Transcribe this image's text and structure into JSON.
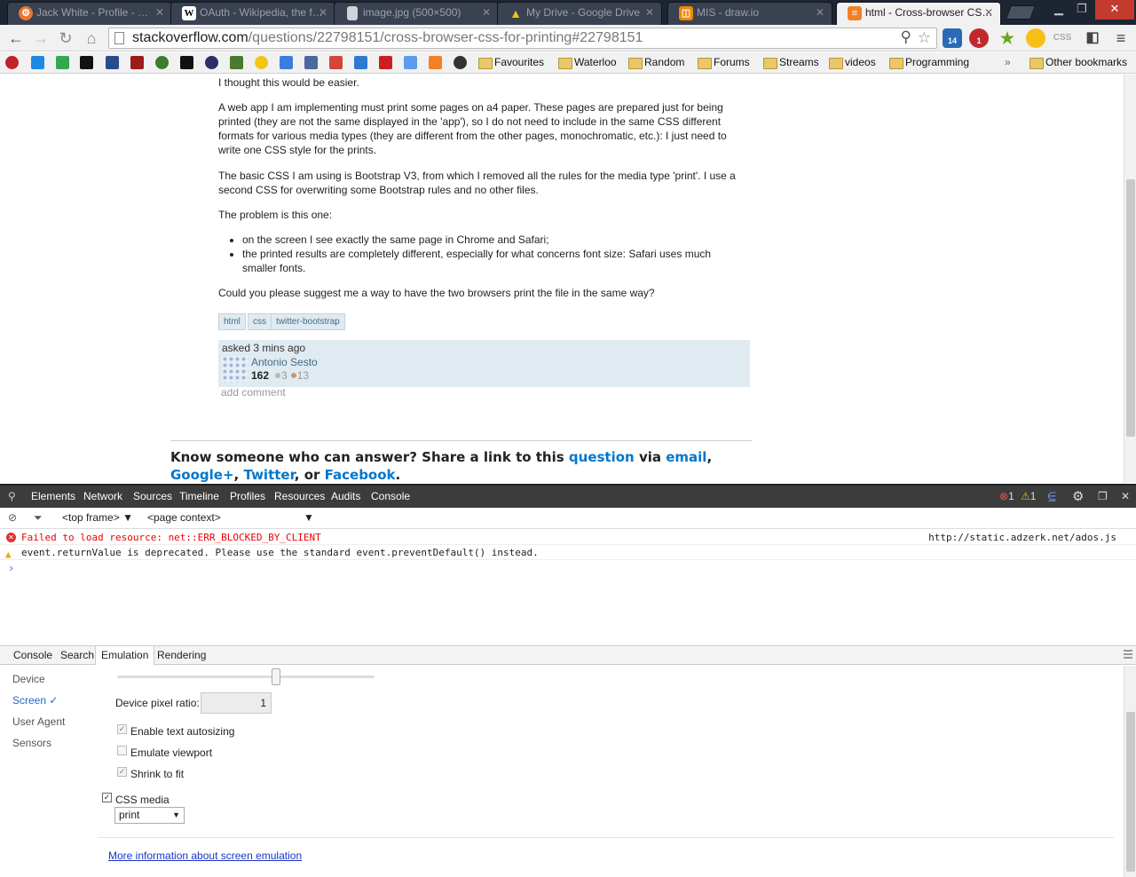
{
  "tabs": [
    {
      "title": "Jack White - Profile - …",
      "favicon_color": "#e8772e",
      "favicon_glyph": "⚙"
    },
    {
      "title": "OAuth - Wikipedia, the f…",
      "favicon_color": "#ffffff",
      "favicon_glyph": "W"
    },
    {
      "title": "image.jpg (500×500)",
      "favicon_color": "#cfd3d8",
      "favicon_glyph": ""
    },
    {
      "title": "My Drive - Google Drive",
      "favicon_color": "#2e9e4c",
      "favicon_glyph": "▲"
    },
    {
      "title": "MIS - draw.io",
      "favicon_color": "#f08705",
      "favicon_glyph": "◫"
    },
    {
      "title": "html - Cross-browser CS…",
      "favicon_color": "#f48024",
      "favicon_glyph": "≡"
    }
  ],
  "window_controls": {
    "minimize": "▁",
    "restore": "❐",
    "close": "✕"
  },
  "toolbar": {
    "back": "←",
    "forward": "→",
    "reload": "↻",
    "home": "⌂",
    "url_host": "stackoverflow.com",
    "url_path": "/questions/22798151/cross-browser-css-for-printing#22798151",
    "zoom_icon": "⚲",
    "star_icon": "☆",
    "ext_badge_1": "14",
    "ext_badge_2": "1",
    "ext_css": "CSS",
    "menu_icon": "≡"
  },
  "bookmarks": {
    "folders": [
      "Favourites",
      "Waterloo",
      "Random",
      "Forums",
      "Streams",
      "videos",
      "Programming"
    ],
    "more": "»",
    "other": "Other bookmarks"
  },
  "question": {
    "intro": "I thought this would be easier.",
    "para1": "A web app I am implementing must print some pages on a4 paper. These pages are prepared just for being printed (they are not the same displayed in the 'app'), so I do not need to include in the same CSS different formats for various media types (they are different from the other pages, monochromatic, etc.): I just need to write one CSS style for the prints.",
    "para2": "The basic CSS I am using is Bootstrap V3, from which I removed all the rules for the media type 'print'. I use a second CSS for overwriting some Bootstrap rules and no other files.",
    "para3": "The problem is this one:",
    "bullets": [
      "on the screen I see exactly the same page in Chrome and Safari;",
      "the printed results are completely different, especially for what concerns font size: Safari uses much smaller fonts."
    ],
    "para4": "Could you please suggest me a way to have the two browsers print the file in the same way?",
    "tags": [
      "html",
      "css",
      "twitter-bootstrap"
    ],
    "asked": "asked 3 mins ago",
    "user": "Antonio Sesto",
    "reputation": "162",
    "silver": "3",
    "bronze": "13",
    "add_comment": "add comment"
  },
  "share": {
    "prefix": "Know someone who can answer? Share a link to this ",
    "question_link": "question",
    "via": " via ",
    "email": "email",
    "comma1": ", ",
    "gplus": "Google+",
    "comma2": ",",
    "twitter": "Twitter",
    "or": ", or ",
    "facebook": "Facebook",
    "end": "."
  },
  "devtools": {
    "tabs": [
      "Elements",
      "Network",
      "Sources",
      "Timeline",
      "Profiles",
      "Resources",
      "Audits",
      "Console"
    ],
    "error_count": "1",
    "warning_count": "1",
    "frame": "<top frame>",
    "context": "<page context>",
    "messages": [
      {
        "level": "error",
        "text": "Failed to load resource: net::ERR_BLOCKED_BY_CLIENT",
        "source": "http://static.adzerk.net/ados.js"
      },
      {
        "level": "warning",
        "text": "event.returnValue is deprecated. Please use the standard event.preventDefault() instead.",
        "source": ""
      }
    ],
    "prompt": "›",
    "drawer_tabs": [
      "Console",
      "Search",
      "Emulation",
      "Rendering"
    ],
    "emulation": {
      "side": [
        "Device",
        "Screen",
        "User Agent",
        "Sensors"
      ],
      "screen_check": "✓",
      "dpr_label": "Device pixel ratio:",
      "dpr_value": "1",
      "text_autosizing": "Enable text autosizing",
      "emulate_viewport": "Emulate viewport",
      "shrink_to_fit": "Shrink to fit",
      "css_media": "CSS media",
      "css_media_value": "print",
      "more_info": "More information about screen emulation"
    }
  },
  "colors": {
    "link": "#0077cc",
    "tag_bg": "#e0eaf1",
    "error": "#d33333",
    "devtools_bar": "#3c3c3c"
  }
}
